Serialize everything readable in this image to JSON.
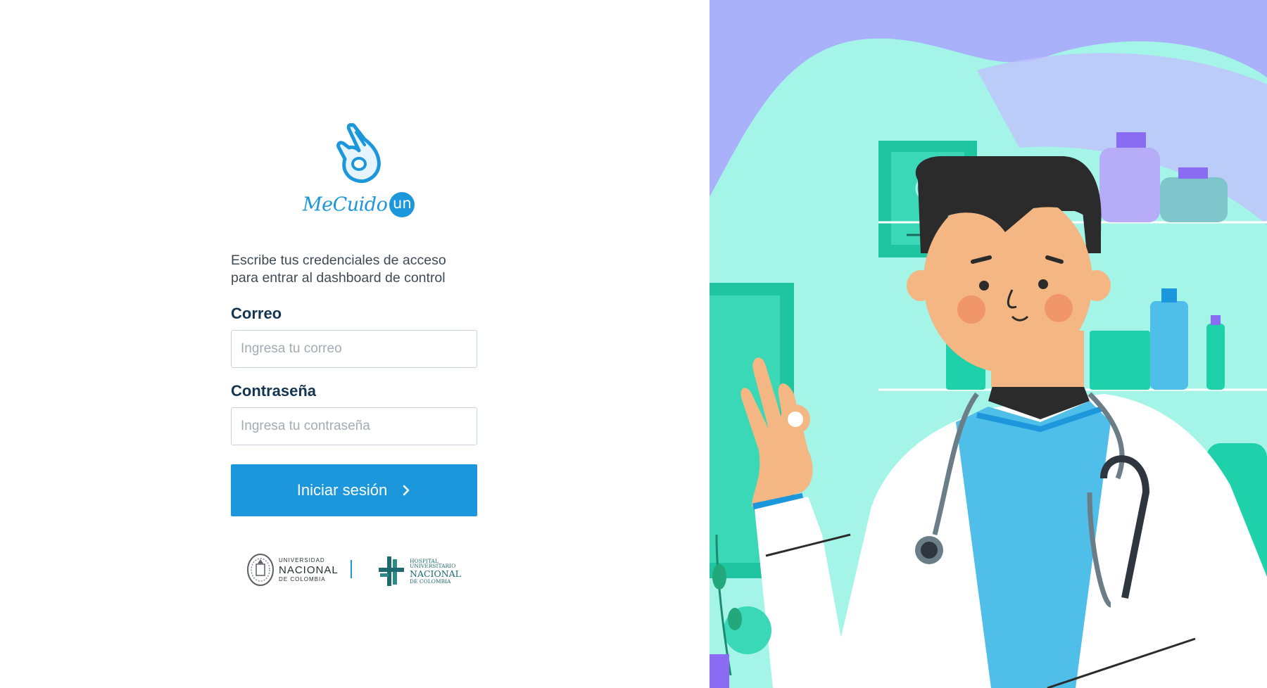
{
  "brand": {
    "name": "MeCuido",
    "badge": "un",
    "accent_color": "#1d97dc"
  },
  "login": {
    "intro_line1": "Escribe tus credenciales de acceso",
    "intro_line2": "para entrar al dashboard de control",
    "email_label": "Correo",
    "email_placeholder": "Ingresa tu correo",
    "password_label": "Contraseña",
    "password_placeholder": "Ingresa tu contraseña",
    "submit_label": "Iniciar sesión",
    "submit_icon": "chevron-right-icon"
  },
  "partners": {
    "university": {
      "top": "UNIVERSIDAD",
      "main": "NACIONAL",
      "sub": "DE COLOMBIA"
    },
    "hospital": {
      "line1": "HOSPITAL",
      "line2": "UNIVERSITARIO",
      "main": "NACIONAL",
      "sub": "DE COLOMBIA"
    }
  },
  "illustration": {
    "subject": "doctor-ok-gesture-illustration",
    "background_colors": [
      "#a9b1fa",
      "#a4f5e8",
      "#1fd1aa"
    ]
  }
}
